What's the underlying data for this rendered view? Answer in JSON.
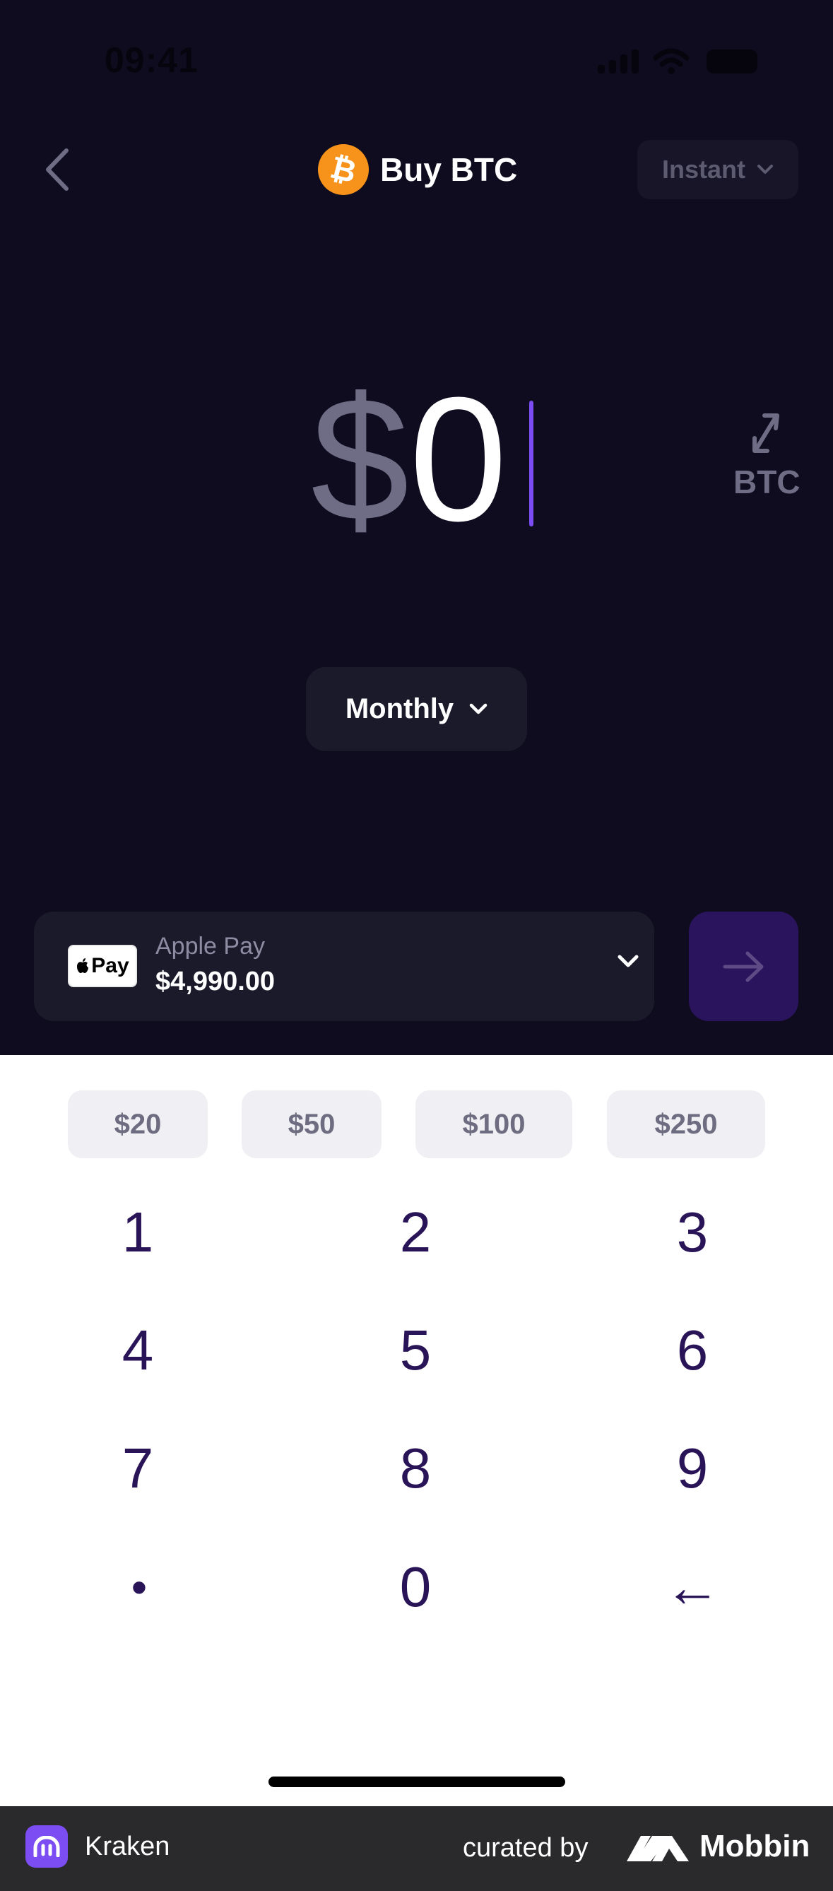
{
  "status_bar": {
    "time": "09:41"
  },
  "header": {
    "title": "Buy BTC",
    "speed_label": "Instant"
  },
  "amount": {
    "currency_symbol": "$",
    "value": "0",
    "toggle_label": "BTC"
  },
  "frequency": {
    "label": "Monthly"
  },
  "payment": {
    "method_name": "Apple Pay",
    "logo_text": "Pay",
    "balance": "$4,990.00"
  },
  "quick_amounts": [
    "$20",
    "$50",
    "$100",
    "$250"
  ],
  "keys": [
    "1",
    "2",
    "3",
    "4",
    "5",
    "6",
    "7",
    "8",
    "9",
    "•",
    "0",
    "←"
  ],
  "footer": {
    "app_name": "Kraken",
    "curated_by": "curated by",
    "brand": "Mobbin"
  },
  "colors": {
    "accent": "#7b4df2",
    "bitcoin": "#f7931a",
    "background": "#0e0c1e",
    "keypad_text": "#2a1458"
  }
}
